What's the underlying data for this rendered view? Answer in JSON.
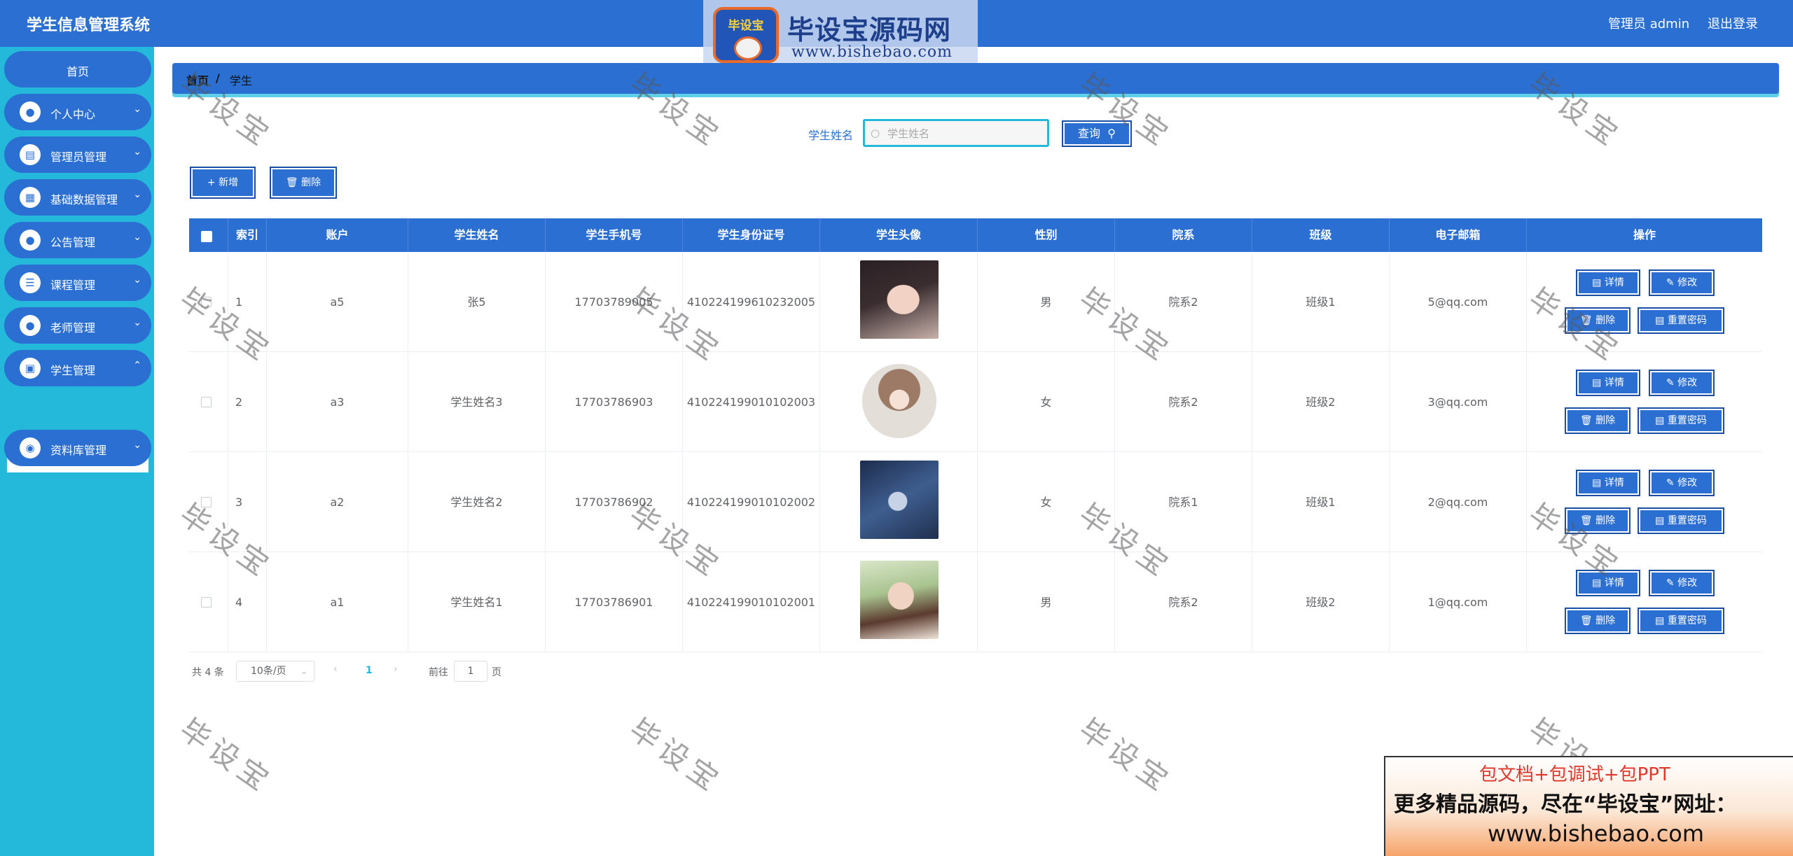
{
  "app": {
    "title": "学生信息管理系统",
    "user": "管理员 admin",
    "logout": "退出登录"
  },
  "logo": {
    "badge": "毕设宝",
    "title": "毕设宝源码网",
    "url": "www.bishebao.com"
  },
  "sidebar": {
    "home": "首页",
    "items": [
      {
        "label": "个人中心",
        "icon": "user-icon"
      },
      {
        "label": "管理员管理",
        "icon": "clipboard-icon"
      },
      {
        "label": "基础数据管理",
        "icon": "grid-icon"
      },
      {
        "label": "公告管理",
        "icon": "user-icon"
      },
      {
        "label": "课程管理",
        "icon": "list-icon"
      },
      {
        "label": "老师管理",
        "icon": "user-icon"
      },
      {
        "label": "学生管理",
        "icon": "wallet-icon"
      },
      {
        "label": "资料库管理",
        "icon": "location-icon"
      }
    ],
    "active_sub": "学生管理"
  },
  "breadcrumb": {
    "home": "首页",
    "sep": "/",
    "current": "学生"
  },
  "search": {
    "label": "学生姓名",
    "placeholder": "学生姓名",
    "button": "查询"
  },
  "toolbar": {
    "add": "新增",
    "delete": "删除"
  },
  "table": {
    "headers": [
      "索引",
      "账户",
      "学生姓名",
      "学生手机号",
      "学生身份证号",
      "学生头像",
      "性别",
      "院系",
      "班级",
      "电子邮箱",
      "操作"
    ],
    "rows": [
      {
        "index": "1",
        "account": "a5",
        "name": "张5",
        "phone": "17703789005",
        "id_card": "410224199610232005",
        "gender": "男",
        "dept": "院系2",
        "class": "班级1",
        "email": "5@qq.com"
      },
      {
        "index": "2",
        "account": "a3",
        "name": "学生姓名3",
        "phone": "17703786903",
        "id_card": "410224199010102003",
        "gender": "女",
        "dept": "院系2",
        "class": "班级2",
        "email": "3@qq.com"
      },
      {
        "index": "3",
        "account": "a2",
        "name": "学生姓名2",
        "phone": "17703786902",
        "id_card": "410224199010102002",
        "gender": "女",
        "dept": "院系1",
        "class": "班级1",
        "email": "2@qq.com"
      },
      {
        "index": "4",
        "account": "a1",
        "name": "学生姓名1",
        "phone": "17703786901",
        "id_card": "410224199010102001",
        "gender": "男",
        "dept": "院系2",
        "class": "班级2",
        "email": "1@qq.com"
      }
    ],
    "actions": {
      "detail": "详情",
      "edit": "修改",
      "delete": "删除",
      "reset": "重置密码"
    }
  },
  "pagination": {
    "total": "共 4 条",
    "size": "10条/页",
    "page": "1",
    "goto_prefix": "前往",
    "goto_value": "1",
    "goto_suffix": "页"
  },
  "watermark": "毕设宝",
  "promo": {
    "line1": "包文档+包调试+包PPT",
    "line2": "更多精品源码，尽在“毕设宝”网址：",
    "line3": "www.bishebao.com"
  },
  "colors": {
    "primary": "#2a6fd1",
    "sidebar": "#24b8da",
    "accent": "#5fd0e8"
  }
}
